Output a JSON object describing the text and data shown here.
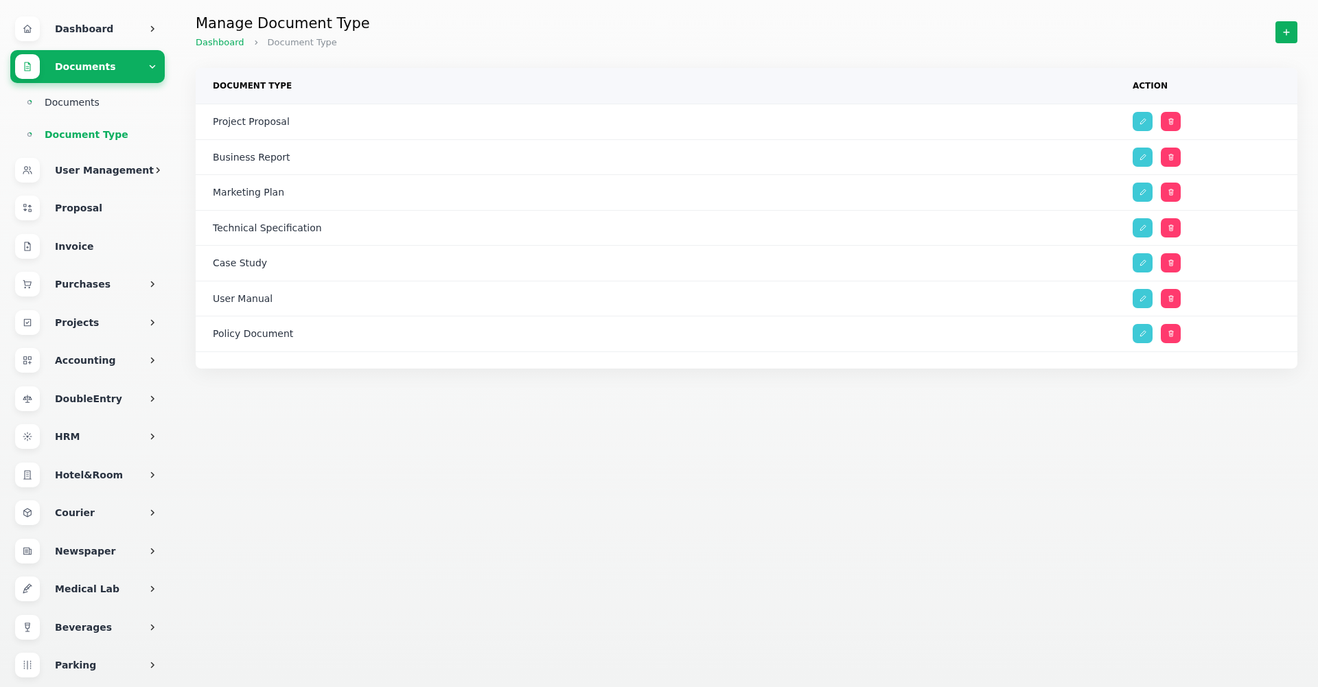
{
  "sidebar": {
    "items": [
      {
        "label": "Dashboard",
        "expanded": false,
        "selected": false
      },
      {
        "label": "Documents",
        "expanded": true,
        "selected": true,
        "children": [
          {
            "label": "Documents",
            "selected": false
          },
          {
            "label": "Document Type",
            "selected": true
          }
        ]
      },
      {
        "label": "User Management",
        "expanded": false,
        "selected": false
      },
      {
        "label": "Proposal",
        "selected": false
      },
      {
        "label": "Invoice",
        "selected": false
      },
      {
        "label": "Purchases",
        "expanded": false,
        "selected": false
      },
      {
        "label": "Projects",
        "expanded": false,
        "selected": false
      },
      {
        "label": "Accounting",
        "expanded": false,
        "selected": false
      },
      {
        "label": "DoubleEntry",
        "expanded": false,
        "selected": false
      },
      {
        "label": "HRM",
        "expanded": false,
        "selected": false
      },
      {
        "label": "Hotel&Room",
        "expanded": false,
        "selected": false
      },
      {
        "label": "Courier",
        "expanded": false,
        "selected": false
      },
      {
        "label": "Newspaper",
        "expanded": false,
        "selected": false
      },
      {
        "label": "Medical Lab",
        "expanded": false,
        "selected": false
      },
      {
        "label": "Beverages",
        "expanded": false,
        "selected": false
      },
      {
        "label": "Parking",
        "expanded": false,
        "selected": false
      }
    ]
  },
  "page": {
    "title": "Manage Document Type",
    "breadcrumb": [
      "Dashboard",
      "Document Type"
    ]
  },
  "table": {
    "columns": [
      "DOCUMENT TYPE",
      "ACTION"
    ],
    "rows": [
      {
        "document_type": "Project Proposal"
      },
      {
        "document_type": "Business Report"
      },
      {
        "document_type": "Marketing Plan"
      },
      {
        "document_type": "Technical Specification"
      },
      {
        "document_type": "Case Study"
      },
      {
        "document_type": "User Manual"
      },
      {
        "document_type": "Policy Document"
      }
    ]
  }
}
